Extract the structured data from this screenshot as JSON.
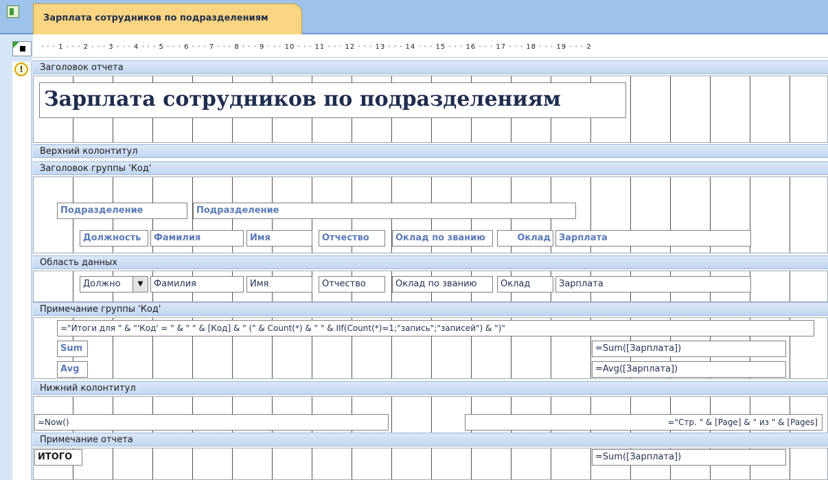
{
  "tab": {
    "title": "Зарплата сотрудников по подразделениям"
  },
  "ruler": {
    "marks": "· · · 1 · · · 2 · · · 3 · · · 4 · · · 5 · · · 6 · · · 7 · · · 8 · · · 9 · · · 10 · · · 11 · · · 12 · · · 13 · · · 14 · · · 15 · · · 16 · · · 17 · · · 18 · · · 19 · · · 2"
  },
  "sections": {
    "report_header": "Заголовок отчета",
    "page_header": "Верхний колонтитул",
    "group_header": "Заголовок группы 'Код'",
    "detail": "Область данных",
    "group_footer": "Примечание группы 'Код'",
    "page_footer": "Нижний колонтитул",
    "report_footer": "Примечание отчета"
  },
  "report_title": "Зарплата сотрудников по подразделениям",
  "group_header": {
    "subdivision_label": "Подразделение",
    "subdivision_field": "Подразделение",
    "labels": [
      "Должность",
      "Фамилия",
      "Имя",
      "Отчество",
      "Оклад по званию",
      "Оклад",
      "Зарплата"
    ]
  },
  "detail": {
    "fields": [
      "Должно",
      "Фамилия",
      "Имя",
      "Отчество",
      "Оклад по званию",
      "Оклад",
      "Зарплата"
    ]
  },
  "group_footer": {
    "summary_expr": "=\"Итоги для \" & \"'Код' = \" & \" \" & [Код] & \" (\" & Count(*) & \" \" & IIf(Count(*)=1;\"запись\";\"записей\") & \")\"",
    "sum_label": "Sum",
    "avg_label": "Avg",
    "sum_expr": "=Sum([Зарплата])",
    "avg_expr": "=Avg([Зарплата])"
  },
  "page_footer": {
    "now_expr": "=Now()",
    "page_expr": "=\"Стр. \" & [Page] & \" из \" & [Pages]"
  },
  "report_footer": {
    "total_label": "ИТОГО",
    "sum_expr": "=Sum([Зарплата])"
  }
}
